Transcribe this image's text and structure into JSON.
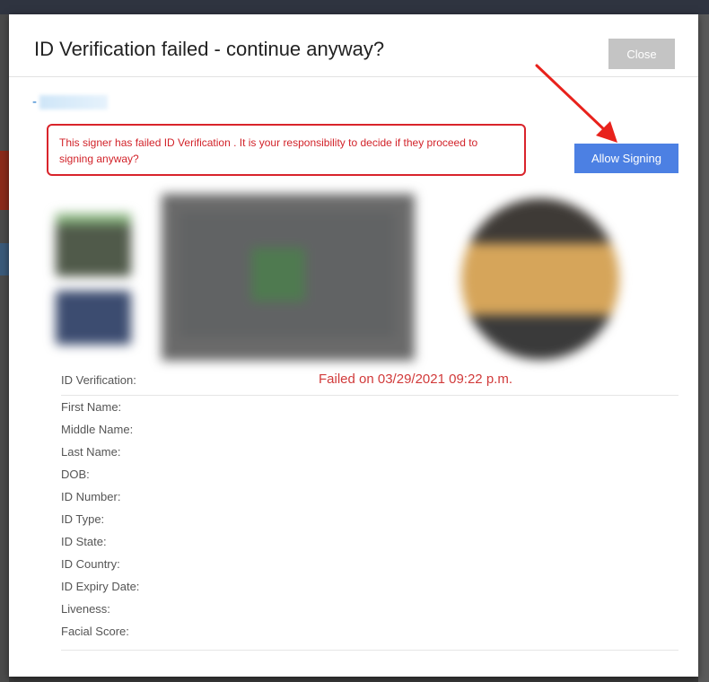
{
  "modal": {
    "title": "ID Verification failed - continue anyway?",
    "close_label": "Close"
  },
  "signer": {
    "name_prefix": "-"
  },
  "warning": {
    "text": "This signer has failed ID Verification . It is your responsibility to decide if they proceed to signing anyway?"
  },
  "allow_signing_label": "Allow Signing",
  "verification": {
    "label": "ID Verification:",
    "status": "Failed on 03/29/2021 09:22 p.m."
  },
  "fields": [
    {
      "label": "First Name:"
    },
    {
      "label": "Middle Name:"
    },
    {
      "label": "Last Name:"
    },
    {
      "label": "DOB:"
    },
    {
      "label": "ID Number:"
    },
    {
      "label": "ID Type:"
    },
    {
      "label": "ID State:"
    },
    {
      "label": "ID Country:"
    },
    {
      "label": "ID Expiry Date:"
    },
    {
      "label": "Liveness:"
    },
    {
      "label": "Facial Score:"
    }
  ],
  "colors": {
    "warning_red": "#d2232a",
    "allow_blue": "#4c80e3",
    "close_gray": "#c4c4c4",
    "link_blue": "#1a73c9"
  }
}
